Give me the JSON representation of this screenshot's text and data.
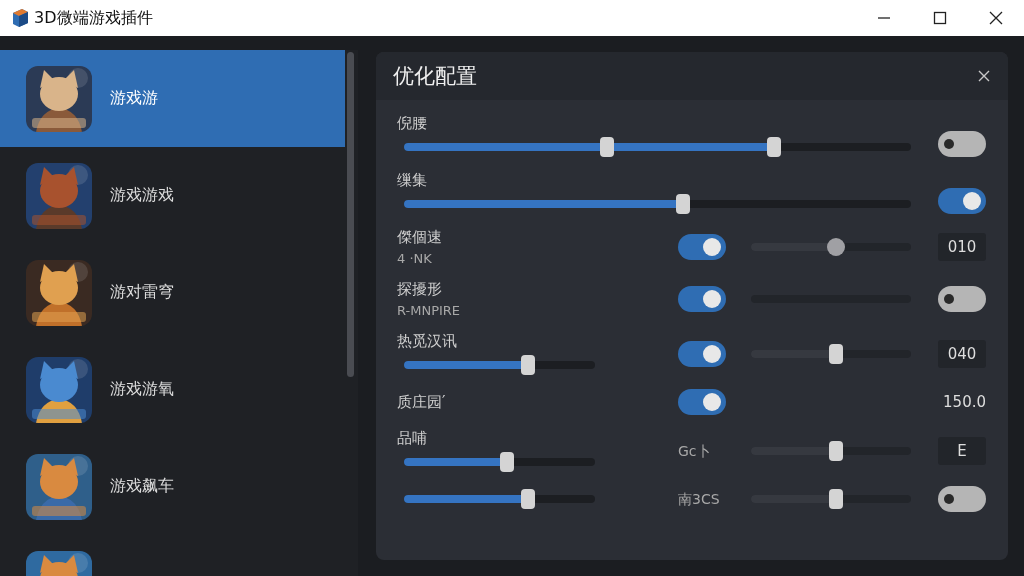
{
  "window": {
    "title": "3D微端游戏插件"
  },
  "sidebar": {
    "items": [
      {
        "label": "游戏游",
        "selected": true
      },
      {
        "label": "游戏游戏",
        "selected": false
      },
      {
        "label": "游对雷穹",
        "selected": false
      },
      {
        "label": "游戏游氧",
        "selected": false
      },
      {
        "label": "游戏飙车",
        "selected": false
      },
      {
        "selected": false
      }
    ]
  },
  "panel": {
    "title": "优化配置",
    "rows": [
      {
        "label": "倪腰",
        "wide_slider": {
          "handles": [
            {
              "level": 0.4
            },
            {
              "level": 0.73
            }
          ]
        },
        "end": {
          "kind": "toggle",
          "on": false
        }
      },
      {
        "label": "缫集",
        "wide_slider": {
          "handles": [
            {
              "level": 0.55
            }
          ]
        },
        "end": {
          "kind": "toggle",
          "on": true
        }
      },
      {
        "label": "傑個速",
        "sublabel": "4 ·NK",
        "toggle": {
          "on": true
        },
        "slider": {
          "level": 0.53
        },
        "end": {
          "kind": "box",
          "text": "010"
        }
      },
      {
        "label": "探擾形",
        "sublabel": "R-MNPIRE",
        "toggle": {
          "on": true
        },
        "slider": {
          "kind": "empty"
        },
        "end": {
          "kind": "toggle",
          "on": false
        }
      },
      {
        "label": "热觅汉讯",
        "left_slider": {
          "level": 0.65
        },
        "toggle": {
          "on": true
        },
        "slider": {
          "level": 0.53
        },
        "end": {
          "kind": "box",
          "text": "040"
        }
      },
      {
        "label": "质庄园′",
        "toggle": {
          "on": true
        },
        "end": {
          "kind": "plain",
          "text": "150.0"
        }
      },
      {
        "label": "品哺",
        "left_slider": {
          "level": 0.54
        },
        "mid_label": "Gc卜",
        "slider": {
          "level": 0.53
        },
        "end": {
          "kind": "box",
          "text": "E"
        }
      },
      {
        "left_slider": {
          "level": 0.65
        },
        "mid_label": "南3CS",
        "slider": {
          "level": 0.53
        },
        "end": {
          "kind": "toggle",
          "on": false
        }
      }
    ]
  }
}
